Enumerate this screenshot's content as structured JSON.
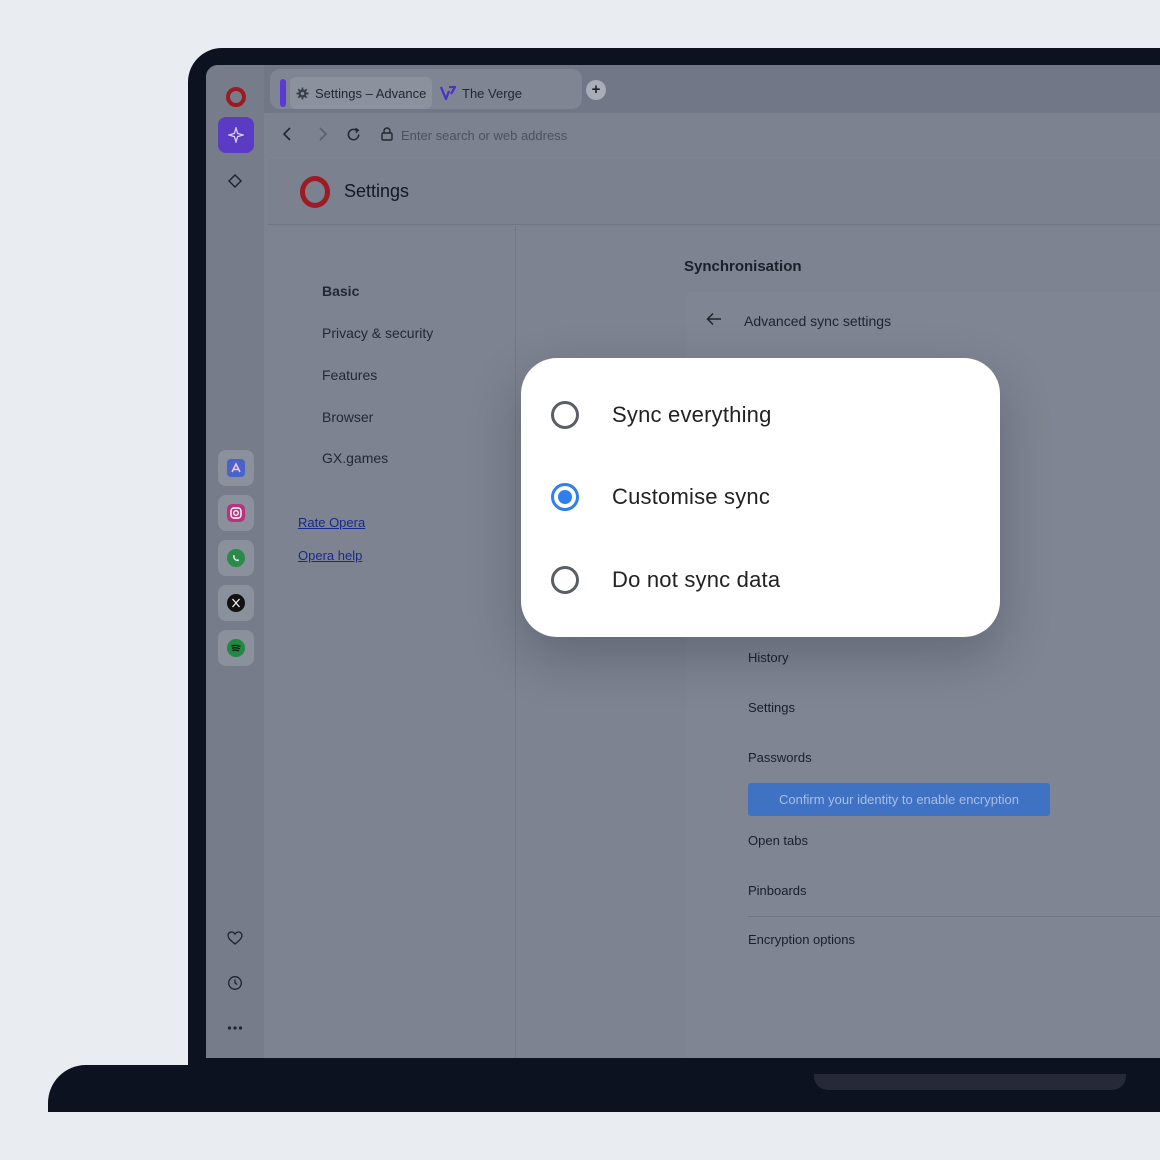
{
  "browser": {
    "tabs": [
      {
        "label": "Settings – Advance",
        "icon": "gear-icon",
        "active": true
      },
      {
        "label": "The Verge",
        "icon": "verge-logo-icon",
        "active": false
      }
    ],
    "new_tab_label": "+",
    "address_placeholder": "Enter search or web address"
  },
  "settings": {
    "title": "Settings",
    "nav": [
      "Basic",
      "Privacy & security",
      "Features",
      "Browser",
      "GX.games"
    ],
    "links": [
      "Rate Opera",
      "Opera help"
    ]
  },
  "sync": {
    "section_title": "Synchronisation",
    "advanced_title": "Advanced sync settings",
    "items": [
      "History",
      "Settings",
      "Passwords",
      "Open tabs",
      "Pinboards",
      "Encryption options"
    ],
    "confirm_button": "Confirm your identity to enable encryption"
  },
  "popup": {
    "options": [
      "Sync everything",
      "Customise sync",
      "Do not sync data"
    ],
    "selected_index": 1
  },
  "colors": {
    "accent": "#2f7ff0",
    "opera_red": "#9c1a22",
    "aria_purple": "#5b3bc4"
  }
}
